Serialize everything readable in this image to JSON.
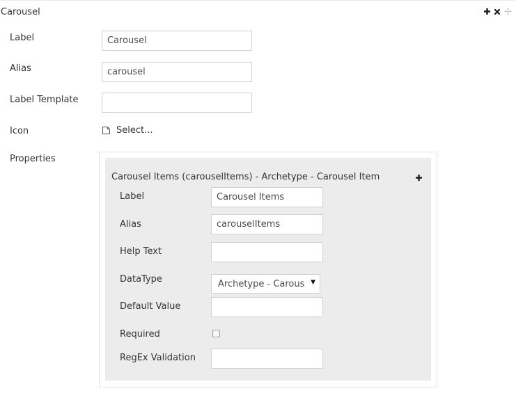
{
  "section": {
    "title": "Carousel",
    "actions": [
      "plus-icon",
      "close-icon",
      "move-icon"
    ]
  },
  "fields": {
    "label": {
      "label": "Label",
      "value": "Carousel"
    },
    "alias": {
      "label": "Alias",
      "value": "carousel"
    },
    "label_template": {
      "label": "Label Template",
      "value": ""
    },
    "icon": {
      "label": "Icon",
      "select_text": "Select...",
      "icon": "page-icon"
    },
    "properties_label": "Properties"
  },
  "property": {
    "header": "Carousel Items (carouselItems) - Archetype - Carousel Item",
    "add_icon": "plus-icon",
    "label": {
      "label": "Label",
      "value": "Carousel Items"
    },
    "alias": {
      "label": "Alias",
      "value": "carouselItems"
    },
    "help_text": {
      "label": "Help Text",
      "value": ""
    },
    "datatype": {
      "label": "DataType",
      "selected": "Archetype - Carousel Item"
    },
    "default_value": {
      "label": "Default Value",
      "value": ""
    },
    "required": {
      "label": "Required",
      "checked": false
    },
    "regex": {
      "label": "RegEx Validation",
      "value": ""
    }
  },
  "colors": {
    "text": "#343434",
    "border": "#d0d0d0",
    "panel": "#ececec"
  }
}
